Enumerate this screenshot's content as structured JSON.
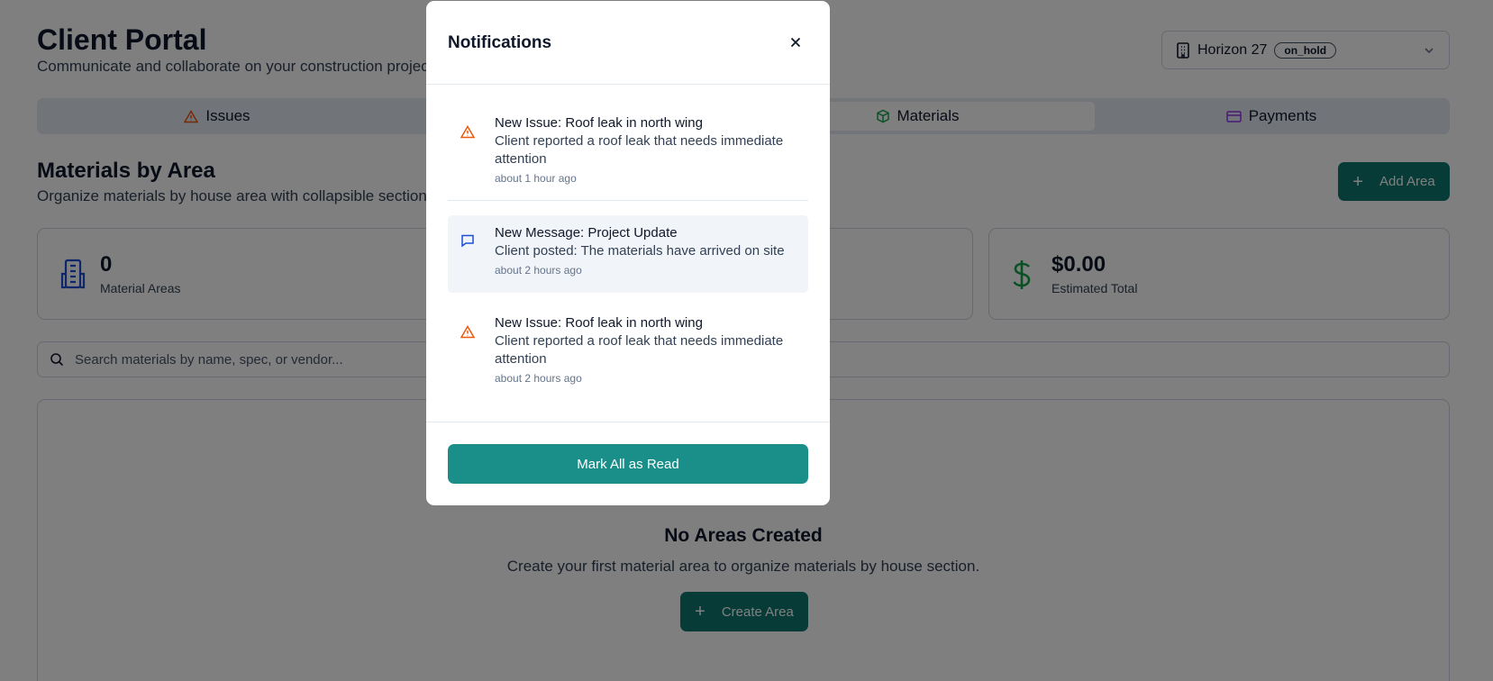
{
  "header": {
    "title": "Client Portal",
    "subtitle": "Communicate and collaborate on your construction projects"
  },
  "project_selector": {
    "name": "Horizon 27",
    "status": "on_hold"
  },
  "tabs": [
    {
      "label": "Issues",
      "icon": "warning-icon",
      "color": "#ea580c"
    },
    {
      "label": "Materials",
      "icon": "package-icon",
      "color": "#16a34a",
      "active": true
    },
    {
      "label": "Payments",
      "icon": "credit-card-icon",
      "color": "#9333ea"
    }
  ],
  "materials": {
    "title": "Materials by Area",
    "subtitle": "Organize materials by house area with collapsible sections",
    "add_area_label": "Add Area",
    "stats": [
      {
        "value": "0",
        "label": "Material Areas",
        "icon": "building-icon",
        "color": "#1d4ed8"
      },
      {
        "value": "$0.00",
        "label": "Estimated Total",
        "icon": "dollar-icon",
        "color": "#16a34a"
      }
    ],
    "search_placeholder": "Search materials by name, spec, or vendor...",
    "empty": {
      "title": "No Areas Created",
      "subtitle": "Create your first material area to organize materials by house section.",
      "button_label": "Create Area"
    }
  },
  "notifications_modal": {
    "title": "Notifications",
    "items": [
      {
        "icon": "warning-icon",
        "title": "New Issue: Roof leak in north wing",
        "message": "Client reported a roof leak that needs immediate attention",
        "time": "about 1 hour ago"
      },
      {
        "icon": "message-icon",
        "title": "New Message: Project Update",
        "message": "Client posted: The materials have arrived on site",
        "time": "about 2 hours ago"
      },
      {
        "icon": "warning-icon",
        "title": "New Issue: Roof leak in north wing",
        "message": "Client reported a roof leak that needs immediate attention",
        "time": "about 2 hours ago"
      }
    ],
    "mark_all_label": "Mark All as Read"
  },
  "colors": {
    "accent": "#0f766e",
    "modal_button": "#1a8f8a",
    "warning": "#ea580c",
    "message": "#1d4ed8"
  }
}
